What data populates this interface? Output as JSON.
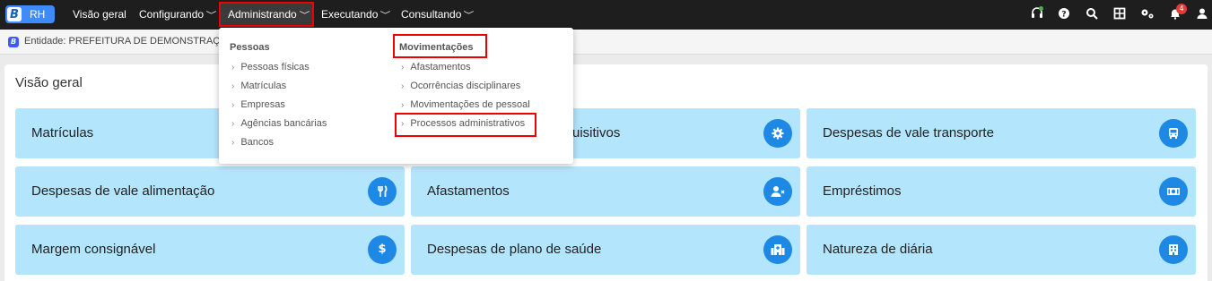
{
  "topbar": {
    "logo_text": "RH",
    "logo_letter": "B",
    "nav": [
      "Visão geral",
      "Configurando",
      "Administrando",
      "Executando",
      "Consultando"
    ],
    "notification_count": "4",
    "icons": [
      "headset-icon",
      "help-icon",
      "search-icon",
      "apps-icon",
      "settings-icon",
      "bell-icon",
      "user-icon"
    ]
  },
  "entity": {
    "text": "Entidade: PREFEITURA DE DEMONSTRAÇÃO"
  },
  "dropdown": {
    "col1_title": "Pessoas",
    "col1_items": [
      "Pessoas físicas",
      "Matrículas",
      "Empresas",
      "Agências bancárias",
      "Bancos"
    ],
    "col2_title": "Movimentações",
    "col2_items": [
      "Afastamentos",
      "Ocorrências disciplinares",
      "Movimentações de pessoal",
      "Processos administrativos"
    ]
  },
  "main": {
    "title": "Visão geral",
    "cards": [
      {
        "label": "Matrículas",
        "icon": "id-icon"
      },
      {
        "label": "uisitivos",
        "icon": "gear-icon"
      },
      {
        "label": "Despesas de vale transporte",
        "icon": "bus-icon"
      },
      {
        "label": "Despesas de vale alimentação",
        "icon": "utensils-icon"
      },
      {
        "label": "Afastamentos",
        "icon": "user-x-icon"
      },
      {
        "label": "Empréstimos",
        "icon": "money-icon"
      },
      {
        "label": "Margem consignável",
        "icon": "dollar-icon"
      },
      {
        "label": "Despesas de plano de saúde",
        "icon": "hospital-icon"
      },
      {
        "label": "Natureza de diária",
        "icon": "building-icon"
      }
    ]
  },
  "colors": {
    "accent": "#1e88e5",
    "card_bg": "#b3e5fc",
    "topbar": "#1e1e1e",
    "highlight": "#ee0000"
  }
}
